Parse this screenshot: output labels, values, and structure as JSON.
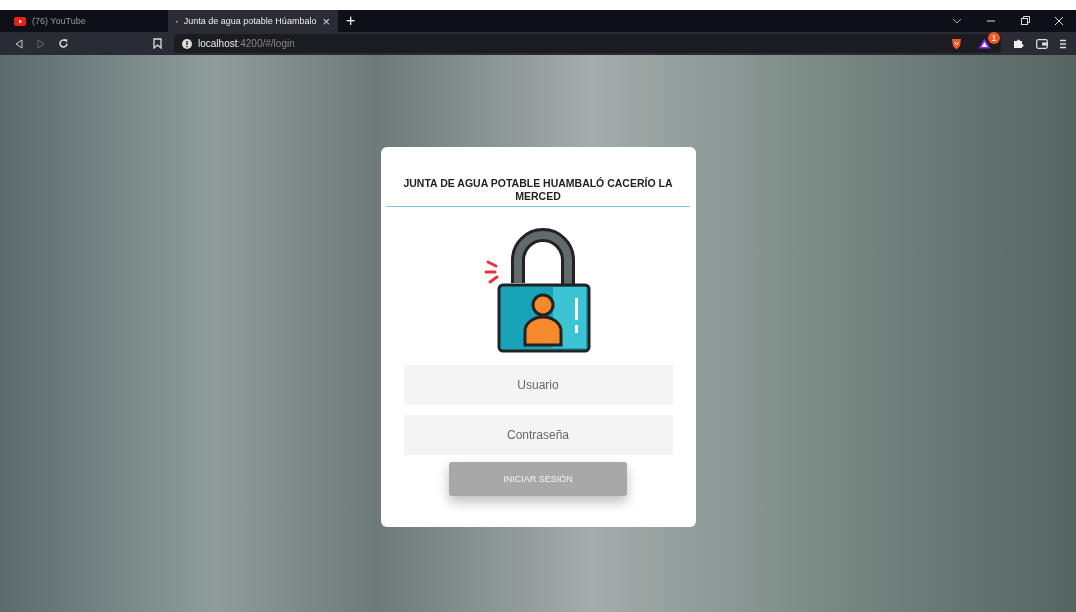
{
  "browser": {
    "tabs": [
      {
        "title": "(76) YouTube",
        "kind": "video",
        "selected": false
      },
      {
        "title": "Junta de agua potable Húambalo",
        "kind": "drop",
        "selected": true
      }
    ],
    "new_tab": "+",
    "close_tab": "×",
    "address": {
      "host": "localhost",
      "path": ":4200/#/login"
    },
    "notification_count": "1"
  },
  "login": {
    "title": "JUNTA DE AGUA POTABLE HUAMBALÓ CACERÍO LA MERCED",
    "fields": [
      {
        "placeholder": "Usuario"
      },
      {
        "placeholder": "Contraseña"
      }
    ],
    "submit": {
      "label": "INICIAR SESIÓN",
      "disabled": true
    }
  }
}
